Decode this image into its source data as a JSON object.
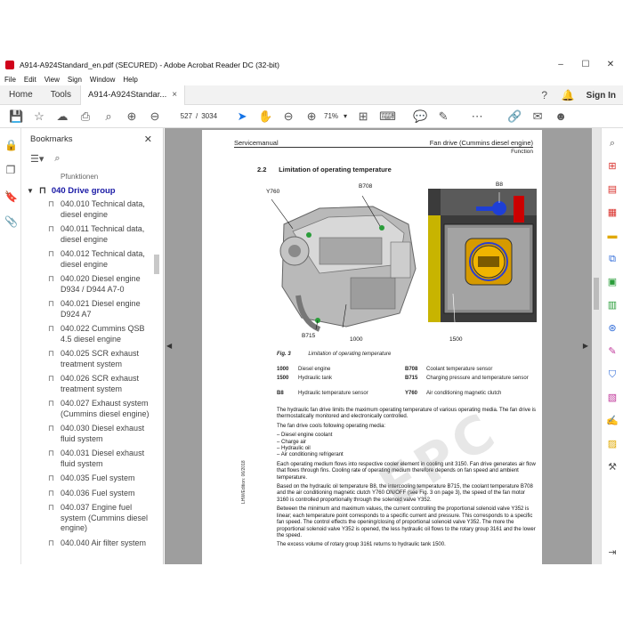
{
  "window": {
    "title": "A914-A924Standard_en.pdf (SECURED) - Adobe Acrobat Reader DC (32-bit)",
    "controls": [
      "–",
      "☐",
      "✕"
    ]
  },
  "menu": [
    "File",
    "Edit",
    "View",
    "Sign",
    "Window",
    "Help"
  ],
  "tabs": {
    "home": "Home",
    "tools": "Tools",
    "document": "A914-A924Standar...",
    "close": "×",
    "sign_in": "Sign In"
  },
  "toolbar": {
    "page_current": "527",
    "page_separator": "/",
    "page_total": "3034",
    "zoom": "71%",
    "zoom_chevron": "▾"
  },
  "bookmarks": {
    "title": "Bookmarks",
    "close": "✕",
    "cut_item": "Pfunktionen",
    "group": "040 Drive group",
    "items": [
      "040.010 Technical data, diesel engine",
      "040.011 Technical data, diesel engine",
      "040.012 Technical data, diesel engine",
      "040.020 Diesel engine D934 / D944 A7-0",
      "040.021 Diesel engine D924 A7",
      "040.022 Cummins QSB 4.5 diesel engine",
      "040.025 SCR exhaust treatment system",
      "040.026 SCR exhaust treatment system",
      "040.027 Exhaust system (Cummins diesel engine)",
      "040.030 Diesel exhaust fluid system",
      "040.031 Diesel exhaust fluid system",
      "040.035 Fuel system",
      "040.036 Fuel system",
      "040.037 Engine fuel system (Cummins diesel engine)",
      "040.040 Air filter system"
    ]
  },
  "page": {
    "header_left": "Servicemanual",
    "header_right": "Fan drive (Cummins diesel engine)",
    "header_sub": "Function",
    "section_number": "2.2",
    "section_title": "Limitation of operating temperature",
    "callouts": {
      "y760": "Y760",
      "b708": "B708",
      "b8": "B8",
      "b715": "B715",
      "c1000": "1000",
      "c1500": "1500"
    },
    "figure_label": "Fig. 3",
    "figure_caption": "Limitation of operating temperature",
    "legend": [
      {
        "c1": "1000",
        "d1": "Diesel engine",
        "c2": "B708",
        "d2": "Coolant temperature sensor"
      },
      {
        "c1": "1500",
        "d1": "Hydraulic tank",
        "c2": "B715",
        "d2": "Charging pressure and temperature sensor"
      },
      {
        "c1": "B8",
        "d1": "Hydraulic temperature sensor",
        "c2": "Y760",
        "d2": "Air conditioning magnetic clutch"
      }
    ],
    "para1": "The hydraulic fan drive limits the maximum operating temperature of various operating media. The fan drive is thermostatically monitored and electronically controlled.",
    "para2": "The fan drive cools following operating media:",
    "list": [
      "Diesel engine coolant",
      "Charge air",
      "Hydraulic oil",
      "Air conditioning refrigerant"
    ],
    "para3": "Each operating medium flows into respective cooler element in cooling unit 3150. Fan drive generates air flow that flows through fins. Cooling rate of operating medium therefore depends on fan speed and ambient temperature.",
    "para4": "Based on the hydraulic oil temperature B8, the intercooling temperature B715, the coolant temperature B708 and the air conditioning magnetic clutch Y760 ON/OFF (see Fig. 3 on page 3), the speed of the fan motor 3160 is controlled proportionally through the solenoid valve Y352.",
    "para5": "Between the minimum and maximum values, the current controlling the proportional solenoid valve Y352 is linear; each temperature point corresponds to a specific current and pressure. This corresponds to a specific fan speed. The control effects the opening/closing of proportional solenoid valve Y352. The more the proportional solenoid valve Y352 is opened, the less hydraulic oil flows to the rotary group 3161 and the lower the speed.",
    "para6": "The excess volume of rotary group 3161 returns to hydraulic tank 1500.",
    "edition": "LHW/Edition: 06/2018"
  },
  "watermark": "EPC",
  "colors": {
    "accent_blue": "#1473e6",
    "bookmark_group": "#1a1aa6",
    "doc_background": "#9e9e9e",
    "app_icon": "#d0021b"
  }
}
